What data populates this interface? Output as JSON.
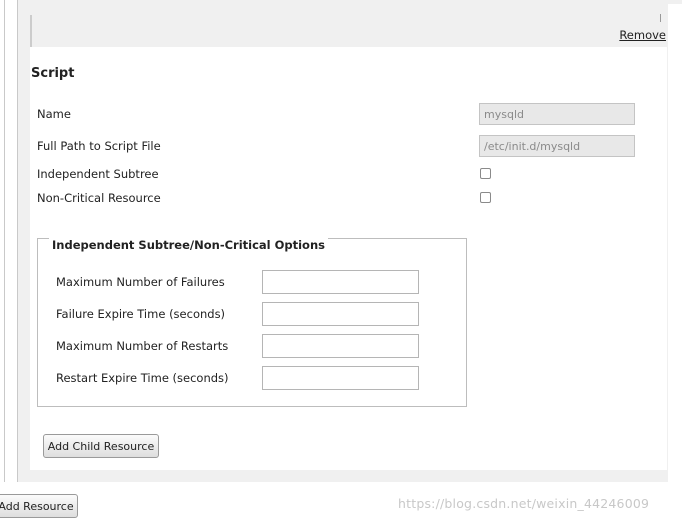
{
  "header": {
    "remove_label": "Remove"
  },
  "script": {
    "title": "Script",
    "fields": [
      {
        "label": "Name",
        "value": "mysqld"
      },
      {
        "label": "Full Path to Script File",
        "value": "/etc/init.d/mysqld"
      }
    ],
    "checkboxes": [
      {
        "label": "Independent Subtree",
        "checked": false
      },
      {
        "label": "Non-Critical Resource",
        "checked": false
      }
    ]
  },
  "options": {
    "legend": "Independent Subtree/Non-Critical Options",
    "fields": [
      {
        "label": "Maximum Number of Failures",
        "value": ""
      },
      {
        "label": "Failure Expire Time (seconds)",
        "value": ""
      },
      {
        "label": "Maximum Number of Restarts",
        "value": ""
      },
      {
        "label": "Restart Expire Time (seconds)",
        "value": ""
      }
    ]
  },
  "buttons": {
    "add_child_resource": "Add Child Resource",
    "add_resource": "Add Resource"
  },
  "watermark": "https://blog.csdn.net/weixin_44246009"
}
